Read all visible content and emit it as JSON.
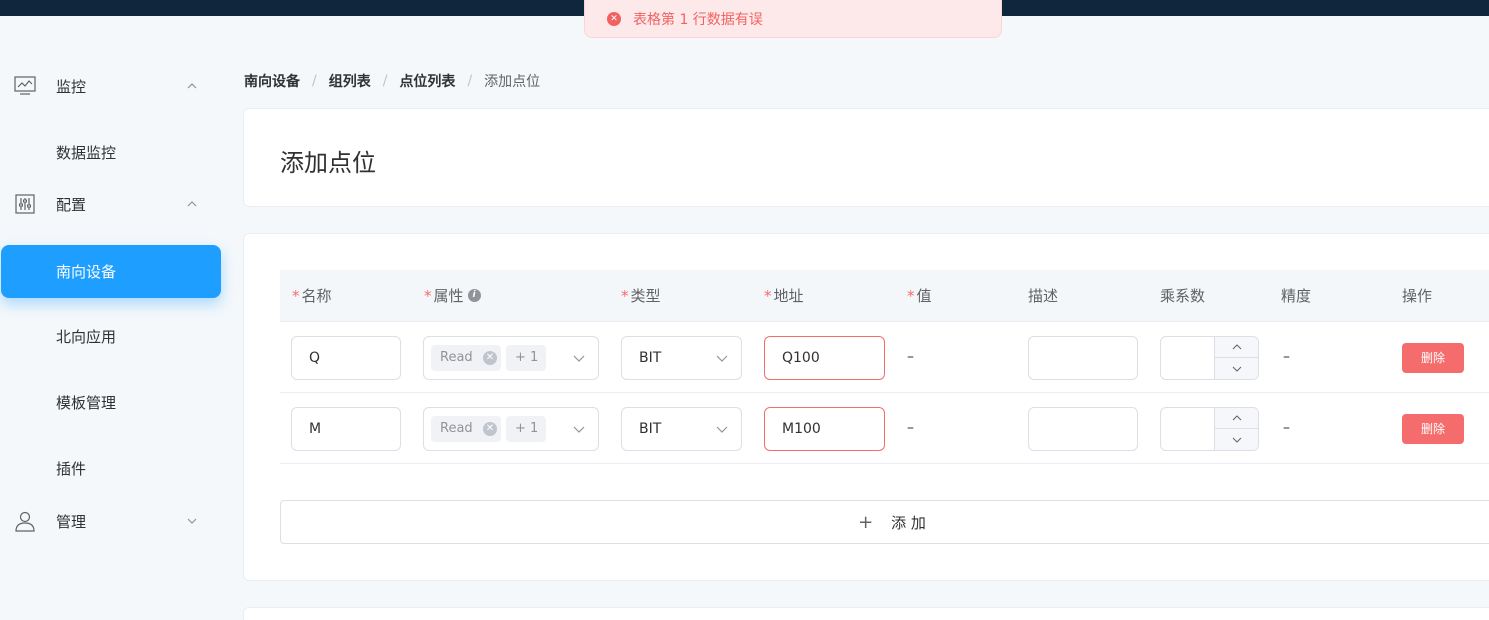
{
  "toast": {
    "message": "表格第 1 行数据有误"
  },
  "sidebar": {
    "monitor": {
      "label": "监控"
    },
    "data_monitor": {
      "label": "数据监控"
    },
    "config": {
      "label": "配置"
    },
    "south_devices": {
      "label": "南向设备"
    },
    "north_apps": {
      "label": "北向应用"
    },
    "templates": {
      "label": "模板管理"
    },
    "plugins": {
      "label": "插件"
    },
    "admin": {
      "label": "管理"
    }
  },
  "breadcrumb": [
    "南向设备",
    "组列表",
    "点位列表",
    "添加点位"
  ],
  "page": {
    "title": "添加点位"
  },
  "table": {
    "headers": {
      "name": "名称",
      "attribute": "属性",
      "type": "类型",
      "address": "地址",
      "value": "值",
      "description": "描述",
      "multiplier": "乘系数",
      "precision": "精度",
      "actions": "操作"
    },
    "required_mark": "*",
    "rows": [
      {
        "name": "Q",
        "attribute_tag": "Read",
        "attribute_more": "+ 1",
        "type": "BIT",
        "address": "Q100",
        "value": "–",
        "description": "",
        "multiplier": "",
        "precision": "–",
        "delete_label": "删除"
      },
      {
        "name": "M",
        "attribute_tag": "Read",
        "attribute_more": "+ 1",
        "type": "BIT",
        "address": "M100",
        "value": "–",
        "description": "",
        "multiplier": "",
        "precision": "–",
        "delete_label": "删除"
      }
    ]
  },
  "add_button": {
    "plus": "+",
    "label": "添 加"
  },
  "colors": {
    "primary": "#1e9fff",
    "danger": "#f56c6c",
    "topbar": "#10263d"
  }
}
